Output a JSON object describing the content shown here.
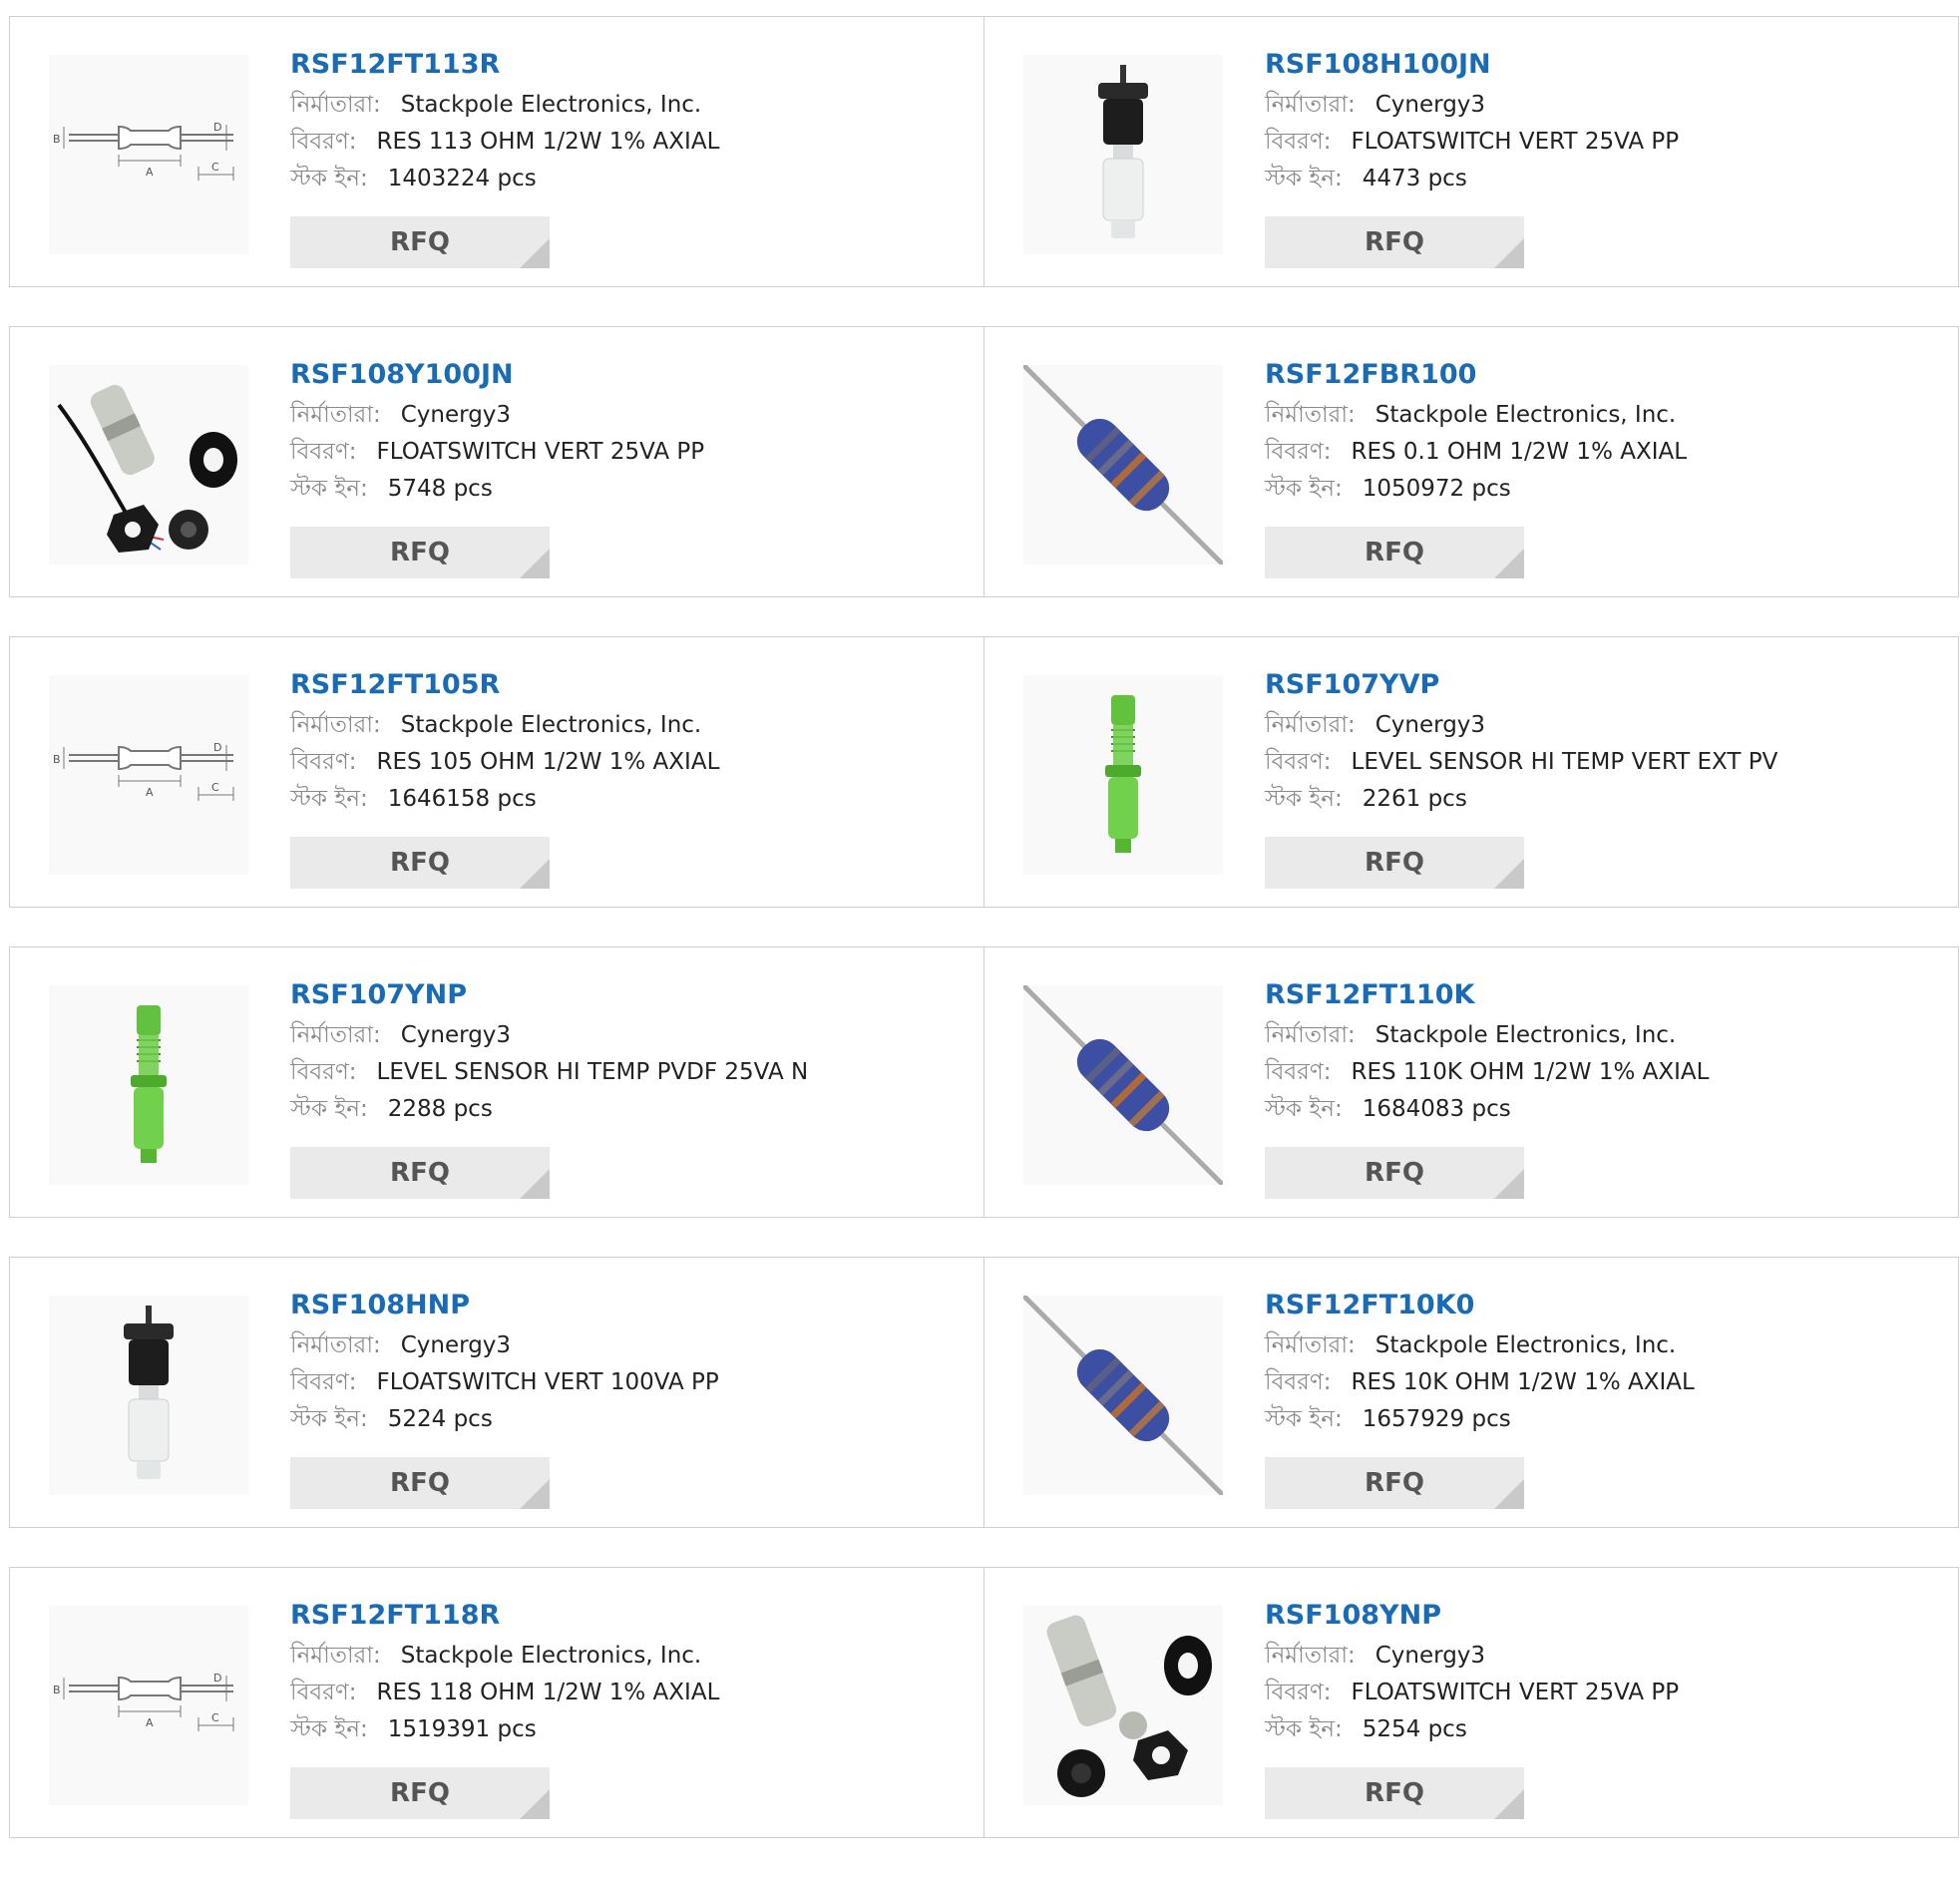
{
  "labels": {
    "manufacturer": "নির্মাতারা:",
    "description": "বিবরণ:",
    "stock": "স্টক ইন:",
    "rfq": "RFQ"
  },
  "products": [
    {
      "part": "RSF12FT113R",
      "manufacturer": "Stackpole Electronics, Inc.",
      "description": "RES 113 OHM 1/2W 1% AXIAL",
      "stock": "1403224 pcs",
      "image": "resistor-drawing-icon"
    },
    {
      "part": "RSF108H100JN",
      "manufacturer": "Cynergy3",
      "description": "FLOATSWITCH VERT 25VA PP",
      "stock": "4473 pcs",
      "image": "float-switch-black-white-icon"
    },
    {
      "part": "RSF108Y100JN",
      "manufacturer": "Cynergy3",
      "description": "FLOATSWITCH VERT 25VA PP",
      "stock": "5748 pcs",
      "image": "float-switch-kit-cable-icon"
    },
    {
      "part": "RSF12FBR100",
      "manufacturer": "Stackpole Electronics, Inc.",
      "description": "RES 0.1 OHM 1/2W 1% AXIAL",
      "stock": "1050972 pcs",
      "image": "blue-resistor-icon"
    },
    {
      "part": "RSF12FT105R",
      "manufacturer": "Stackpole Electronics, Inc.",
      "description": "RES 105 OHM 1/2W 1% AXIAL",
      "stock": "1646158 pcs",
      "image": "resistor-drawing-icon"
    },
    {
      "part": "RSF107YVP",
      "manufacturer": "Cynergy3",
      "description": "LEVEL SENSOR HI TEMP VERT EXT PV",
      "stock": "2261 pcs",
      "image": "green-level-sensor-icon"
    },
    {
      "part": "RSF107YNP",
      "manufacturer": "Cynergy3",
      "description": "LEVEL SENSOR HI TEMP PVDF 25VA N",
      "stock": "2288 pcs",
      "image": "green-level-sensor-icon"
    },
    {
      "part": "RSF12FT110K",
      "manufacturer": "Stackpole Electronics, Inc.",
      "description": "RES 110K OHM 1/2W 1% AXIAL",
      "stock": "1684083 pcs",
      "image": "blue-resistor-icon"
    },
    {
      "part": "RSF108HNP",
      "manufacturer": "Cynergy3",
      "description": "FLOATSWITCH VERT 100VA PP",
      "stock": "5224 pcs",
      "image": "float-switch-black-white-icon"
    },
    {
      "part": "RSF12FT10K0",
      "manufacturer": "Stackpole Electronics, Inc.",
      "description": "RES 10K OHM 1/2W 1% AXIAL",
      "stock": "1657929 pcs",
      "image": "blue-resistor-icon"
    },
    {
      "part": "RSF12FT118R",
      "manufacturer": "Stackpole Electronics, Inc.",
      "description": "RES 118 OHM 1/2W 1% AXIAL",
      "stock": "1519391 pcs",
      "image": "resistor-drawing-icon"
    },
    {
      "part": "RSF108YNP",
      "manufacturer": "Cynergy3",
      "description": "FLOATSWITCH VERT 25VA PP",
      "stock": "5254 pcs",
      "image": "float-switch-kit-icon"
    }
  ],
  "colors": {
    "link": "#1a6bb5",
    "label": "#8a8a8a",
    "rfq_bg": "#eaeaea",
    "border": "#cfcfcf"
  }
}
